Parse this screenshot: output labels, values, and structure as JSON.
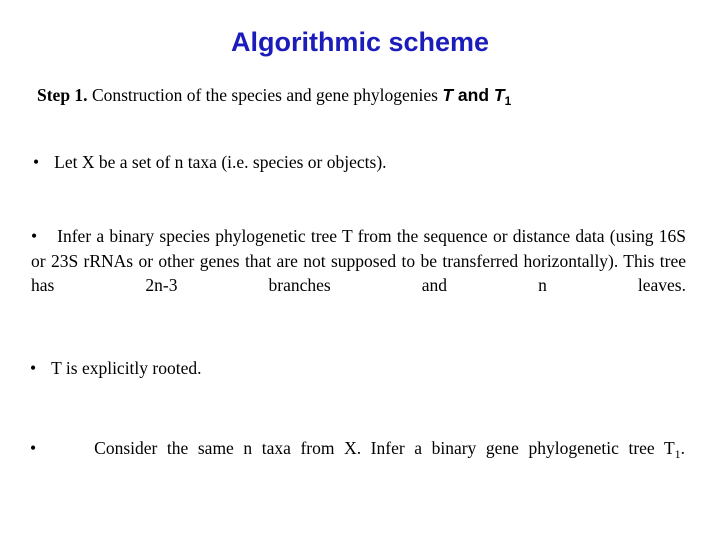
{
  "slide": {
    "title": "Algorithmic scheme",
    "title_color": "#1c1cbb",
    "background_color": "#ffffff",
    "text_color": "#000000",
    "bullet_glyph": "•"
  },
  "step": {
    "label": "Step 1.",
    "text": " Construction of the species and gene phylogenies ",
    "tree_species": "T",
    "conjunction": " and ",
    "tree_gene": "T",
    "tree_gene_subscript": "1"
  },
  "bullets": [
    {
      "id": "bullet-taxa-set",
      "segments": [
        {
          "text": "Let "
        },
        {
          "text": "X",
          "style": "italic"
        },
        {
          "text": " be a set of "
        },
        {
          "text": "n",
          "style": "italic"
        },
        {
          "text": " taxa (i.e. species or objects)."
        }
      ],
      "plain": "Let X be a set of n taxa (i.e. species or objects)."
    },
    {
      "id": "bullet-infer-species-tree",
      "segments": [
        {
          "text": "Infer a binary "
        },
        {
          "text": "species",
          "style": "italic"
        },
        {
          "text": " phylogenetic tree "
        },
        {
          "text": "T",
          "style": "italic"
        },
        {
          "text": " from the sequence or distance data (using 16S or 23S rRNAs or other genes that are not supposed to be transferred horizontally). This tree has 2"
        },
        {
          "text": "n",
          "style": "italic"
        },
        {
          "text": "-3 branches and "
        },
        {
          "text": "n",
          "style": "italic"
        },
        {
          "text": " leaves."
        }
      ],
      "plain": "Infer a binary species phylogenetic tree T from the sequence or distance data (using 16S or 23S rRNAs or other genes that are not supposed to be transferred horizontally). This tree has 2n-3 branches and n leaves."
    },
    {
      "id": "bullet-t-rooted",
      "segments": [
        {
          "text": "T",
          "style": "italic"
        },
        {
          "text": " is explicitly rooted."
        }
      ],
      "plain": "T is explicitly rooted."
    },
    {
      "id": "bullet-infer-gene-tree",
      "segments": [
        {
          "text": "Consider the same "
        },
        {
          "text": "n",
          "style": "italic"
        },
        {
          "text": " taxa from "
        },
        {
          "text": "X",
          "style": "italic"
        },
        {
          "text": ". Infer a binary "
        },
        {
          "text": "gene",
          "style": "italic"
        },
        {
          "text": " phylogenetic tree "
        },
        {
          "text": "T",
          "style": "italic"
        },
        {
          "text": "1",
          "style": "subscript"
        },
        {
          "text": "."
        }
      ],
      "plain": "Consider the same n taxa from X. Infer a binary gene phylogenetic tree T1."
    }
  ]
}
